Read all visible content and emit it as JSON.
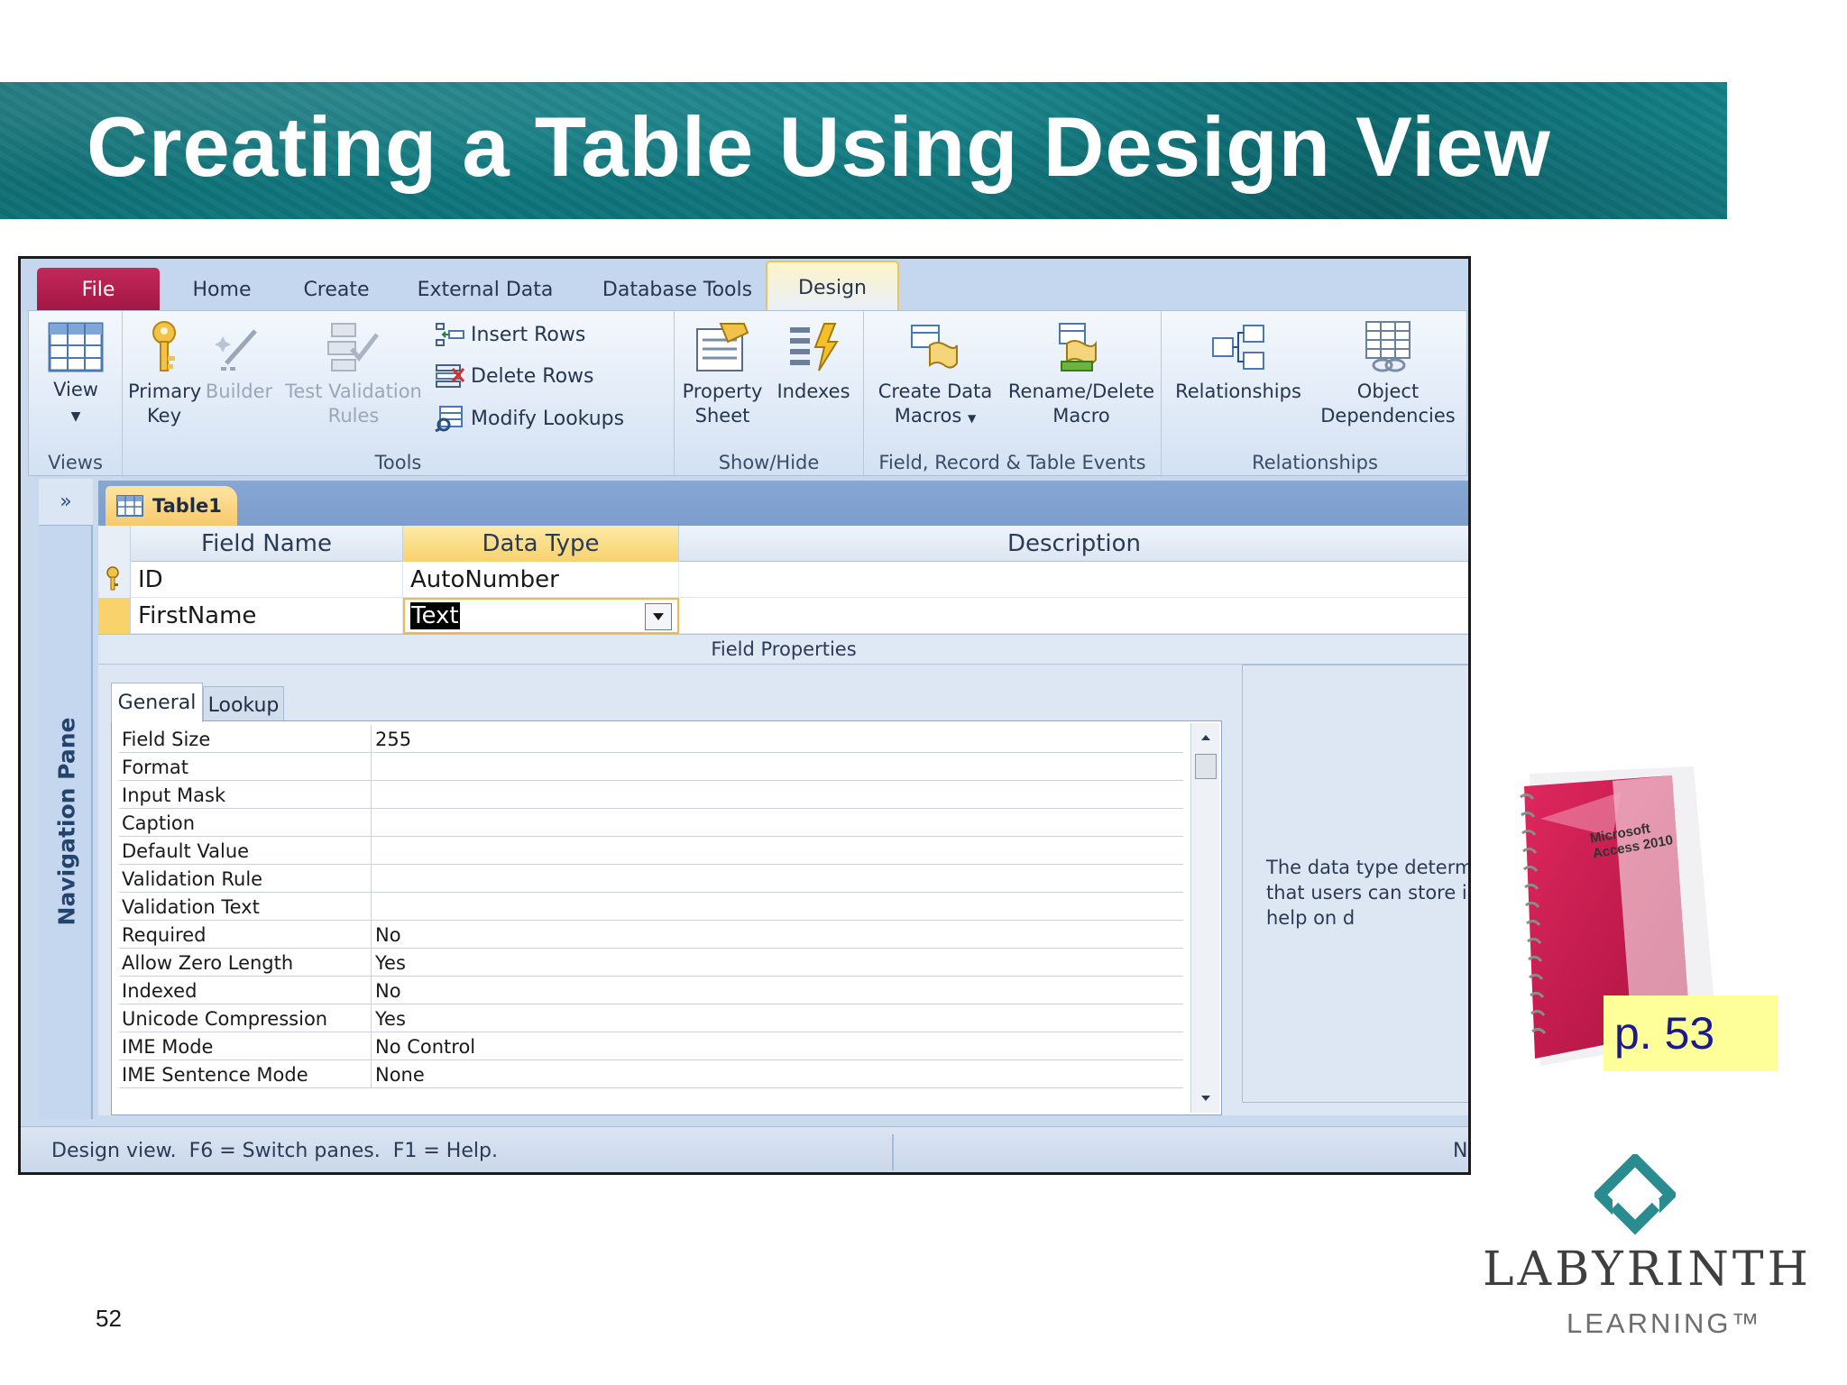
{
  "slide": {
    "title": "Creating a Table Using Design View",
    "page_ref": "p. 53",
    "slide_number": "52",
    "logo": {
      "name": "LABYRINTH",
      "sub": "LEARNING™"
    }
  },
  "ribbon": {
    "tabs": [
      "File",
      "Home",
      "Create",
      "External Data",
      "Database Tools",
      "Design"
    ],
    "active_tab": "Design",
    "groups": {
      "views": {
        "label": "Views",
        "view": "View"
      },
      "tools": {
        "label": "Tools",
        "primary_key": [
          "Primary",
          "Key"
        ],
        "builder": "Builder",
        "test_validation": [
          "Test Validation",
          "Rules"
        ],
        "insert_rows": "Insert Rows",
        "delete_rows": "Delete Rows",
        "modify_lookups": "Modify Lookups"
      },
      "show_hide": {
        "label": "Show/Hide",
        "property_sheet": [
          "Property",
          "Sheet"
        ],
        "indexes": "Indexes"
      },
      "events": {
        "label": "Field, Record & Table Events",
        "create_data_macros": [
          "Create Data",
          "Macros"
        ],
        "rename_delete_macro": [
          "Rename/Delete",
          "Macro"
        ]
      },
      "relationships": {
        "label": "Relationships",
        "relationships": "Relationships",
        "object_dependencies": [
          "Object",
          "Dependencies"
        ]
      }
    }
  },
  "nav_pane": {
    "toggle": "»",
    "label": "Navigation Pane"
  },
  "document": {
    "tab": "Table1",
    "columns": [
      "Field Name",
      "Data Type",
      "Description"
    ],
    "rows": [
      {
        "field": "ID",
        "type": "AutoNumber",
        "description": ""
      },
      {
        "field": "FirstName",
        "type": "Text",
        "description": ""
      }
    ],
    "field_properties_label": "Field Properties",
    "property_tabs": [
      "General",
      "Lookup"
    ],
    "properties": [
      {
        "name": "Field Size",
        "value": "255"
      },
      {
        "name": "Format",
        "value": ""
      },
      {
        "name": "Input Mask",
        "value": ""
      },
      {
        "name": "Caption",
        "value": ""
      },
      {
        "name": "Default Value",
        "value": ""
      },
      {
        "name": "Validation Rule",
        "value": ""
      },
      {
        "name": "Validation Text",
        "value": ""
      },
      {
        "name": "Required",
        "value": "No"
      },
      {
        "name": "Allow Zero Length",
        "value": "Yes"
      },
      {
        "name": "Indexed",
        "value": "No"
      },
      {
        "name": "Unicode Compression",
        "value": "Yes"
      },
      {
        "name": "IME Mode",
        "value": "No Control"
      },
      {
        "name": "IME Sentence Mode",
        "value": "None"
      }
    ],
    "help_text": "The data type determ\nthat users can store i\nhelp on d"
  },
  "status_bar": {
    "left": "Design view.  F6 = Switch panes.  F1 = Help.",
    "right": "Nu"
  },
  "book": {
    "cover_text": [
      "Microsoft",
      "Access 2010"
    ]
  },
  "colors": {
    "banner": "#0f7a80",
    "file_tab": "#b31f4e",
    "active_column": "#f9d26b",
    "page_ref_bg": "#ffff99"
  }
}
